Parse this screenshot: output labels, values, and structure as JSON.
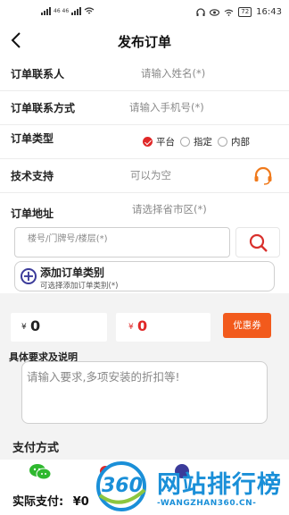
{
  "status_bar": {
    "network_left": "46 46",
    "time": "16:43",
    "battery": "72"
  },
  "nav": {
    "back_icon": "chevron-left-icon",
    "title": "发布订单"
  },
  "form": {
    "contact": {
      "label": "订单联系人",
      "placeholder": "请输入姓名(*)"
    },
    "phone": {
      "label": "订单联系方式",
      "placeholder": "请输入手机号(*)"
    },
    "type": {
      "label": "订单类型",
      "options": [
        "平台",
        "指定",
        "内部"
      ],
      "selected": "平台"
    },
    "support": {
      "label": "技术支持",
      "placeholder": "可以为空",
      "icon": "headset-icon"
    },
    "address": {
      "label": "订单地址",
      "placeholder": "请选择省市区(*)"
    }
  },
  "address_detail": {
    "placeholder": "楼号/门牌号/楼层(*)",
    "search_icon": "search-icon"
  },
  "add_category": {
    "title": "添加订单类别",
    "subtitle": "可选择添加订单类别(*)",
    "icon": "plus-circle-icon"
  },
  "amounts": {
    "total": {
      "currency": "¥",
      "value": "0"
    },
    "discount": {
      "currency": "¥",
      "value": "0"
    },
    "coupon_label": "优惠券"
  },
  "requirements": {
    "label": "具体要求及说明",
    "placeholder": "请输入要求,多项安装的折扣等!"
  },
  "payment": {
    "title": "支付方式",
    "methods": [
      "wechat-icon",
      "alipay-icon"
    ]
  },
  "actual_pay": {
    "label": "实际支付:",
    "currency": "¥",
    "value": "0"
  },
  "watermark": {
    "badge": "360",
    "text": "网站排行榜",
    "url": "-WANGZHAN360.CN-"
  },
  "colors": {
    "accent_red": "#e02828",
    "coupon_orange": "#f25a1c",
    "headset_orange": "#f07a1c",
    "search_red": "#d9302c",
    "watermark_blue": "#1a8fd8"
  }
}
